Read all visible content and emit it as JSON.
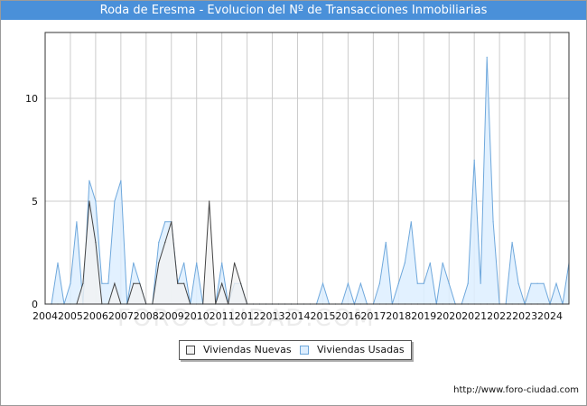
{
  "title": "Roda de Eresma - Evolucion del Nº de Transacciones Inmobiliarias",
  "source": "http://www.foro-ciudad.com",
  "watermark": "FORO-CIUDAD.COM",
  "colors": {
    "header_bg": "#4a90d9",
    "nuevas_fill": "#f2f2f2",
    "nuevas_line": "#444444",
    "usadas_fill": "#ddeeff",
    "usadas_line": "#6fa8dc"
  },
  "legend": {
    "nuevas": "Viviendas Nuevas",
    "usadas": "Viviendas Usadas"
  },
  "chart_data": {
    "type": "area",
    "title": "Roda de Eresma - Evolucion del Nº de Transacciones Inmobiliarias",
    "xlabel": "",
    "ylabel": "",
    "x_ticks": [
      "2004",
      "2005",
      "2006",
      "2007",
      "2008",
      "2009",
      "2010",
      "2011",
      "2012",
      "2013",
      "2014",
      "2015",
      "2016",
      "2017",
      "2018",
      "2019",
      "2020",
      "2021",
      "2022",
      "2023",
      "2024"
    ],
    "y_ticks": [
      0,
      5,
      10
    ],
    "xlim": [
      2004,
      2024.75
    ],
    "ylim": [
      0,
      13.2
    ],
    "grid": true,
    "legend_position": "bottom",
    "series": [
      {
        "name": "Viviendas Nuevas",
        "points": [
          [
            2004.0,
            0
          ],
          [
            2004.25,
            0
          ],
          [
            2004.5,
            0
          ],
          [
            2004.75,
            0
          ],
          [
            2005.0,
            0
          ],
          [
            2005.25,
            0
          ],
          [
            2005.5,
            1
          ],
          [
            2005.75,
            5
          ],
          [
            2006.0,
            3
          ],
          [
            2006.25,
            0
          ],
          [
            2006.5,
            0
          ],
          [
            2006.75,
            1
          ],
          [
            2007.0,
            0
          ],
          [
            2007.25,
            0
          ],
          [
            2007.5,
            1
          ],
          [
            2007.75,
            1
          ],
          [
            2008.0,
            0
          ],
          [
            2008.25,
            0
          ],
          [
            2008.5,
            2
          ],
          [
            2008.75,
            3
          ],
          [
            2009.0,
            4
          ],
          [
            2009.25,
            1
          ],
          [
            2009.5,
            1
          ],
          [
            2009.75,
            0
          ],
          [
            2010.0,
            0
          ],
          [
            2010.25,
            0
          ],
          [
            2010.5,
            5
          ],
          [
            2010.75,
            0
          ],
          [
            2011.0,
            1
          ],
          [
            2011.25,
            0
          ],
          [
            2011.5,
            2
          ],
          [
            2011.75,
            1
          ],
          [
            2012.0,
            0
          ],
          [
            2012.25,
            0
          ],
          [
            2012.5,
            0
          ],
          [
            2012.75,
            0
          ],
          [
            2013.0,
            0
          ],
          [
            2013.25,
            0
          ],
          [
            2013.5,
            0
          ],
          [
            2013.75,
            0
          ],
          [
            2014.0,
            0
          ],
          [
            2014.25,
            0
          ],
          [
            2014.5,
            0
          ],
          [
            2014.75,
            0
          ],
          [
            2015.0,
            0
          ],
          [
            2015.25,
            0
          ],
          [
            2015.5,
            0
          ],
          [
            2015.75,
            0
          ],
          [
            2016.0,
            0
          ],
          [
            2016.25,
            0
          ],
          [
            2016.5,
            0
          ],
          [
            2016.75,
            0
          ],
          [
            2017.0,
            0
          ],
          [
            2017.25,
            0
          ],
          [
            2017.5,
            0
          ],
          [
            2017.75,
            0
          ],
          [
            2018.0,
            0
          ],
          [
            2018.25,
            0
          ],
          [
            2018.5,
            0
          ],
          [
            2018.75,
            0
          ],
          [
            2019.0,
            0
          ],
          [
            2019.25,
            0
          ],
          [
            2019.5,
            0
          ],
          [
            2019.75,
            0
          ],
          [
            2020.0,
            0
          ],
          [
            2020.25,
            0
          ],
          [
            2020.5,
            0
          ],
          [
            2020.75,
            0
          ],
          [
            2021.0,
            0
          ],
          [
            2021.25,
            0
          ],
          [
            2021.5,
            0
          ],
          [
            2021.75,
            0
          ],
          [
            2022.0,
            0
          ],
          [
            2022.25,
            0
          ],
          [
            2022.5,
            0
          ],
          [
            2022.75,
            0
          ],
          [
            2023.0,
            0
          ],
          [
            2023.25,
            0
          ],
          [
            2023.5,
            0
          ],
          [
            2023.75,
            0
          ],
          [
            2024.0,
            0
          ],
          [
            2024.25,
            0
          ],
          [
            2024.5,
            0
          ],
          [
            2024.75,
            0
          ]
        ]
      },
      {
        "name": "Viviendas Usadas",
        "points": [
          [
            2004.0,
            0
          ],
          [
            2004.25,
            0
          ],
          [
            2004.5,
            2
          ],
          [
            2004.75,
            0
          ],
          [
            2005.0,
            1
          ],
          [
            2005.25,
            4
          ],
          [
            2005.5,
            0
          ],
          [
            2005.75,
            6
          ],
          [
            2006.0,
            5
          ],
          [
            2006.25,
            1
          ],
          [
            2006.5,
            1
          ],
          [
            2006.75,
            5
          ],
          [
            2007.0,
            6
          ],
          [
            2007.25,
            0
          ],
          [
            2007.5,
            2
          ],
          [
            2007.75,
            1
          ],
          [
            2008.0,
            0
          ],
          [
            2008.25,
            0
          ],
          [
            2008.5,
            3
          ],
          [
            2008.75,
            4
          ],
          [
            2009.0,
            4
          ],
          [
            2009.25,
            1
          ],
          [
            2009.5,
            2
          ],
          [
            2009.75,
            0
          ],
          [
            2010.0,
            2
          ],
          [
            2010.25,
            0
          ],
          [
            2010.5,
            0
          ],
          [
            2010.75,
            0
          ],
          [
            2011.0,
            2
          ],
          [
            2011.25,
            0
          ],
          [
            2011.5,
            1
          ],
          [
            2011.75,
            1
          ],
          [
            2012.0,
            0
          ],
          [
            2012.25,
            0
          ],
          [
            2012.5,
            0
          ],
          [
            2012.75,
            0
          ],
          [
            2013.0,
            0
          ],
          [
            2013.25,
            0
          ],
          [
            2013.5,
            0
          ],
          [
            2013.75,
            0
          ],
          [
            2014.0,
            0
          ],
          [
            2014.25,
            0
          ],
          [
            2014.5,
            0
          ],
          [
            2014.75,
            0
          ],
          [
            2015.0,
            1
          ],
          [
            2015.25,
            0
          ],
          [
            2015.5,
            0
          ],
          [
            2015.75,
            0
          ],
          [
            2016.0,
            1
          ],
          [
            2016.25,
            0
          ],
          [
            2016.5,
            1
          ],
          [
            2016.75,
            0
          ],
          [
            2017.0,
            0
          ],
          [
            2017.25,
            1
          ],
          [
            2017.5,
            3
          ],
          [
            2017.75,
            0
          ],
          [
            2018.0,
            1
          ],
          [
            2018.25,
            2
          ],
          [
            2018.5,
            4
          ],
          [
            2018.75,
            1
          ],
          [
            2019.0,
            1
          ],
          [
            2019.25,
            2
          ],
          [
            2019.5,
            0
          ],
          [
            2019.75,
            2
          ],
          [
            2020.0,
            1
          ],
          [
            2020.25,
            0
          ],
          [
            2020.5,
            0
          ],
          [
            2020.75,
            1
          ],
          [
            2021.0,
            7
          ],
          [
            2021.25,
            1
          ],
          [
            2021.5,
            12
          ],
          [
            2021.75,
            4
          ],
          [
            2022.0,
            0
          ],
          [
            2022.25,
            0
          ],
          [
            2022.5,
            3
          ],
          [
            2022.75,
            1
          ],
          [
            2023.0,
            0
          ],
          [
            2023.25,
            1
          ],
          [
            2023.5,
            1
          ],
          [
            2023.75,
            1
          ],
          [
            2024.0,
            0
          ],
          [
            2024.25,
            1
          ],
          [
            2024.5,
            0
          ],
          [
            2024.75,
            2
          ]
        ]
      }
    ]
  }
}
